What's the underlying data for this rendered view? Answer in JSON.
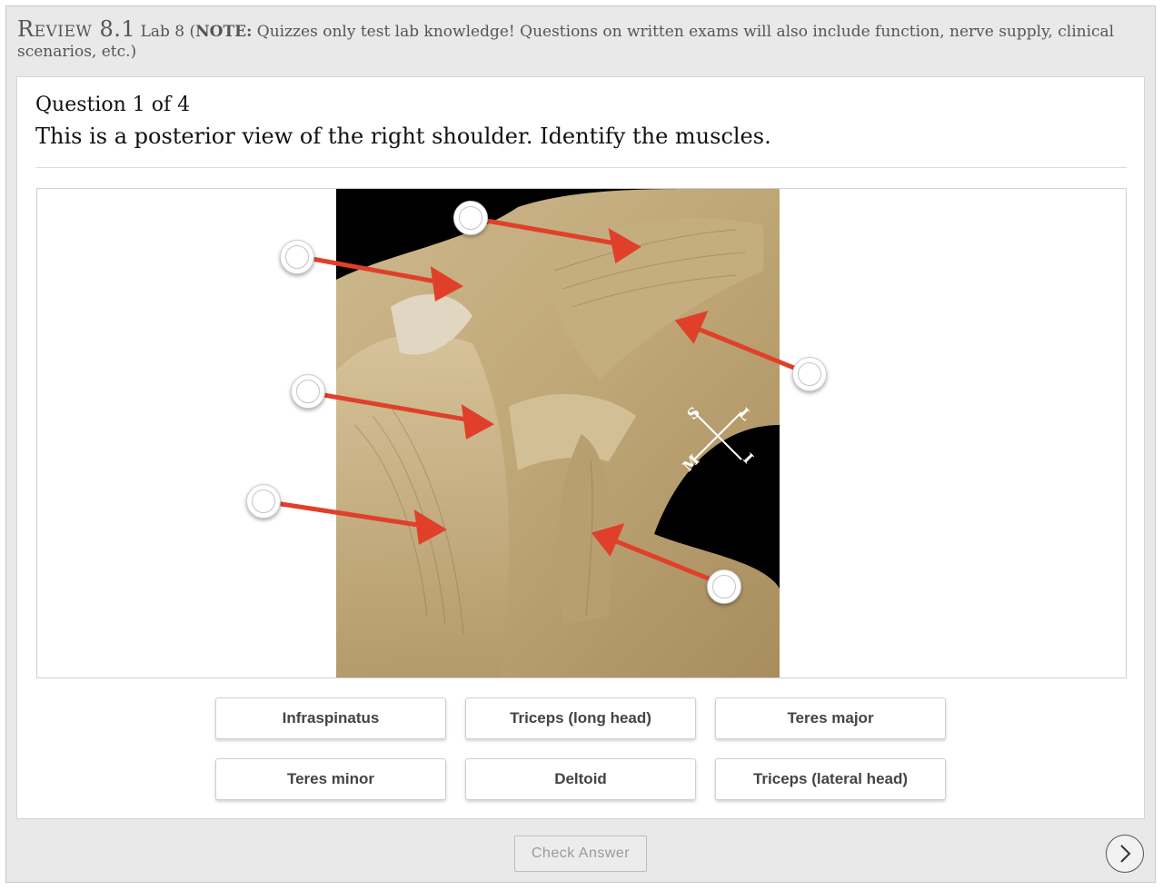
{
  "header": {
    "review_label": "Review 8.1",
    "lab_label": "Lab 8",
    "note_label": "NOTE:",
    "note_text": "Quizzes only test lab knowledge! Questions on written exams will also include function, nerve supply, clinical scenarios, etc.)"
  },
  "question": {
    "counter": "Question 1 of 4",
    "prompt": "This is a posterior view of the right shoulder. Identify the muscles."
  },
  "compass": {
    "s": "S",
    "l": "L",
    "m": "M",
    "i": "I"
  },
  "answers": [
    "Infraspinatus",
    "Triceps (long head)",
    "Teres major",
    "Teres minor",
    "Deltoid",
    "Triceps (lateral head)"
  ],
  "footer": {
    "check_label": "Check Answer"
  },
  "colors": {
    "arrow": "#e0402a",
    "background": "#e9e9e9",
    "specimen_bg": "#000000"
  },
  "icons": {
    "next": "chevron-right-icon"
  }
}
